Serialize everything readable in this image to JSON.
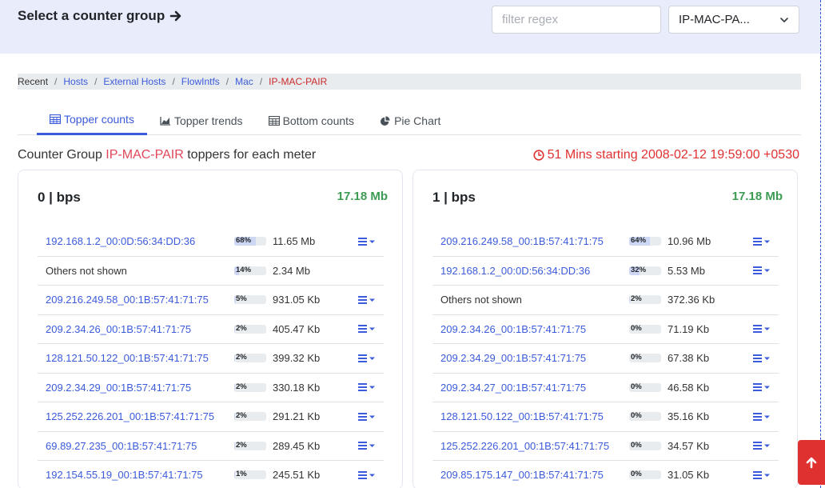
{
  "header": {
    "title": "Select a counter group",
    "filter_placeholder": "filter regex",
    "selected_group": "IP-MAC-PA..."
  },
  "breadcrumb": [
    "Recent",
    "Hosts",
    "External Hosts",
    "FlowIntfs",
    "Mac",
    "IP-MAC-PAIR"
  ],
  "tabs": [
    "Topper counts",
    "Topper trends",
    "Bottom counts",
    "Pie Chart"
  ],
  "summary": {
    "prefix": "Counter Group",
    "group": "IP-MAC-PAIR",
    "suffix": "toppers for each meter",
    "time": "51 Mins starting 2008-02-12 19:59:00 +0530"
  },
  "cards": [
    {
      "title": "0 | bps",
      "total": "17.18 Mb",
      "rows": [
        {
          "key": "192.168.1.2_00:0D:56:34:DD:36",
          "pct": "68%",
          "pct_value": 68,
          "value": "11.65 Mb",
          "link": true
        },
        {
          "key": "Others not shown",
          "pct": "14%",
          "pct_value": 14,
          "value": "2.34 Mb",
          "link": false
        },
        {
          "key": "209.216.249.58_00:1B:57:41:71:75",
          "pct": "5%",
          "pct_value": 5,
          "value": "931.05 Kb",
          "link": true
        },
        {
          "key": "209.2.34.26_00:1B:57:41:71:75",
          "pct": "2%",
          "pct_value": 2,
          "value": "405.47 Kb",
          "link": true
        },
        {
          "key": "128.121.50.122_00:1B:57:41:71:75",
          "pct": "2%",
          "pct_value": 2,
          "value": "399.32 Kb",
          "link": true
        },
        {
          "key": "209.2.34.29_00:1B:57:41:71:75",
          "pct": "2%",
          "pct_value": 2,
          "value": "330.18 Kb",
          "link": true
        },
        {
          "key": "125.252.226.201_00:1B:57:41:71:75",
          "pct": "2%",
          "pct_value": 2,
          "value": "291.21 Kb",
          "link": true
        },
        {
          "key": "69.89.27.235_00:1B:57:41:71:75",
          "pct": "2%",
          "pct_value": 2,
          "value": "289.45 Kb",
          "link": true
        },
        {
          "key": "192.154.55.19_00:1B:57:41:71:75",
          "pct": "1%",
          "pct_value": 1,
          "value": "245.51 Kb",
          "link": true
        }
      ]
    },
    {
      "title": "1 | bps",
      "total": "17.18 Mb",
      "rows": [
        {
          "key": "209.216.249.58_00:1B:57:41:71:75",
          "pct": "64%",
          "pct_value": 64,
          "value": "10.96 Mb",
          "link": true
        },
        {
          "key": "192.168.1.2_00:0D:56:34:DD:36",
          "pct": "32%",
          "pct_value": 32,
          "value": "5.53 Mb",
          "link": true
        },
        {
          "key": "Others not shown",
          "pct": "2%",
          "pct_value": 2,
          "value": "372.36 Kb",
          "link": false
        },
        {
          "key": "209.2.34.26_00:1B:57:41:71:75",
          "pct": "0%",
          "pct_value": 0,
          "value": "71.19 Kb",
          "link": true
        },
        {
          "key": "209.2.34.29_00:1B:57:41:71:75",
          "pct": "0%",
          "pct_value": 0,
          "value": "67.38 Kb",
          "link": true
        },
        {
          "key": "209.2.34.27_00:1B:57:41:71:75",
          "pct": "0%",
          "pct_value": 0,
          "value": "46.58 Kb",
          "link": true
        },
        {
          "key": "128.121.50.122_00:1B:57:41:71:75",
          "pct": "0%",
          "pct_value": 0,
          "value": "35.16 Kb",
          "link": true
        },
        {
          "key": "125.252.226.201_00:1B:57:41:71:75",
          "pct": "0%",
          "pct_value": 0,
          "value": "34.57 Kb",
          "link": true
        },
        {
          "key": "209.85.175.147_00:1B:57:41:71:75",
          "pct": "0%",
          "pct_value": 0,
          "value": "31.05 Kb",
          "link": true
        }
      ]
    }
  ],
  "colors": {
    "accent": "#3b5bdb",
    "total_green": "#3e9b54",
    "time_red": "#e03131",
    "group_red": "#e0475a",
    "topbar_bg": "#e8ecfb"
  },
  "icons": {
    "title_arrow": "arrow-right-icon",
    "row_menu": "menu-dropdown-icon",
    "time": "clock-icon",
    "scroll": "arrow-up-icon"
  }
}
